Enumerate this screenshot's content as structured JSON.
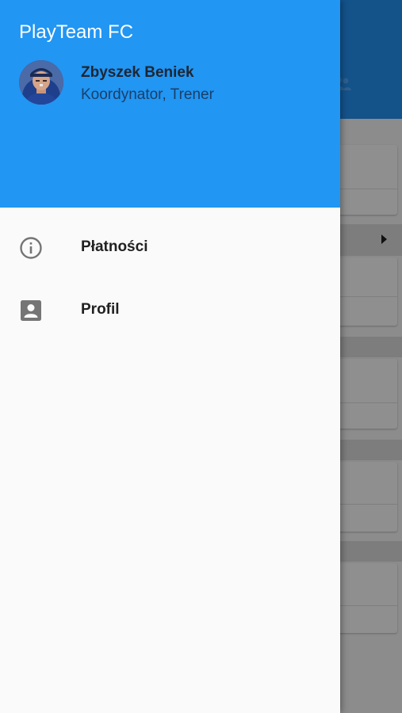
{
  "app": {
    "club_name": "PlayTeam FC"
  },
  "user": {
    "name": "Zbyszek Beniek",
    "role": "Koordynator, Trener"
  },
  "menu": {
    "items": [
      {
        "label": "Płatności",
        "icon": "info-icon"
      },
      {
        "label": "Profil",
        "icon": "account-box-icon"
      }
    ]
  },
  "colors": {
    "header_bg": "#2196f3",
    "drawer_bg": "#fafafa",
    "icon_gray": "#757575",
    "text_dark": "#212121"
  }
}
